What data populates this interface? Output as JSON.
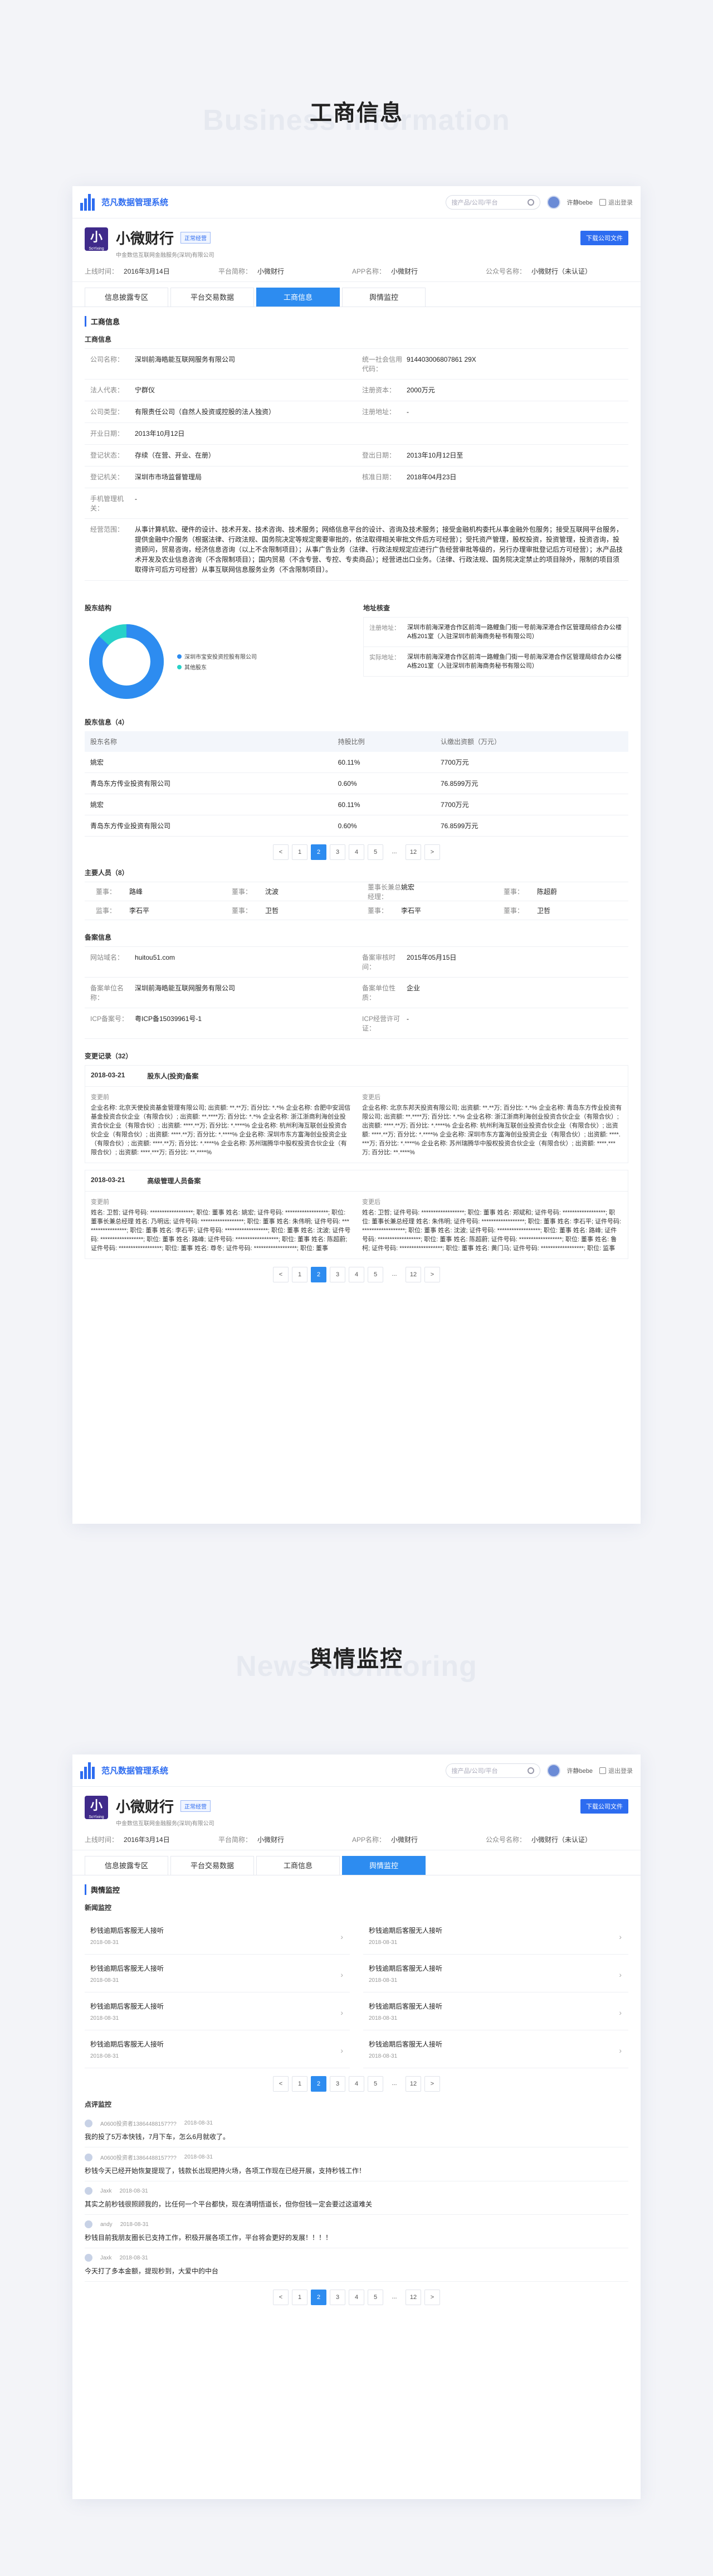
{
  "section1": {
    "title_zh": "工商信息",
    "title_en": "Business Information"
  },
  "section2": {
    "title_zh": "舆情监控",
    "title_en": "News Monitoring"
  },
  "topbar": {
    "system_name": "范凡数据管理系统",
    "search_placeholder": "搜产品/公司/平台",
    "username": "许静bebe",
    "logout": "退出登录"
  },
  "company": {
    "name": "小微财行",
    "tag": "正常经营",
    "subtitle": "中金数信互联网金融服务(深圳)有限公司",
    "download": "下载公司文件",
    "logo_text": "小",
    "logo_small": "SoYixing",
    "info": [
      {
        "k": "上线时间：",
        "v": "2016年3月14日"
      },
      {
        "k": "平台简称：",
        "v": "小微财行"
      },
      {
        "k": "APP名称：",
        "v": "小微财行"
      },
      {
        "k": "公众号名称：",
        "v": "小微财行（未认证）"
      }
    ]
  },
  "tabs": [
    "信息披露专区",
    "平台交易数据",
    "工商信息",
    "舆情监控"
  ],
  "biz": {
    "header": "工商信息",
    "sub1": "工商信息",
    "rows": [
      [
        {
          "k": "公司名称：",
          "v": "深圳前海皓能互联网服务有限公司"
        },
        {
          "k": "统一社会信用代码：",
          "v": "914403006807861 29X"
        }
      ],
      [
        {
          "k": "法人代表：",
          "v": "宁群仪"
        },
        {
          "k": "注册资本：",
          "v": "2000万元"
        }
      ],
      [
        {
          "k": "公司类型：",
          "v": "有限责任公司（自然人投资或控股的法人独资）"
        },
        {
          "k": "注册地址：",
          "v": "-"
        }
      ],
      [
        {
          "k": "开业日期：",
          "v": "2013年10月12日"
        },
        {
          "k": "",
          "v": ""
        }
      ],
      [
        {
          "k": "登记状态：",
          "v": "存续（在营、开业、在册）"
        },
        {
          "k": "登出日期：",
          "v": "2013年10月12日至"
        }
      ],
      [
        {
          "k": "登记机关：",
          "v": "深圳市市场监督管理局"
        },
        {
          "k": "核准日期：",
          "v": "2018年04月23日"
        }
      ],
      [
        {
          "k": "手机管理机关：",
          "v": "-"
        },
        {
          "k": "",
          "v": ""
        }
      ]
    ],
    "scope": {
      "k": "经营范围：",
      "v": "从事计算机软、硬件的设计、技术开发、技术咨询、技术服务；网络信息平台的设计、咨询及技术服务；接受金融机构委托从事金融外包服务；接受互联网平台服务，提供金融中介服务（根据法律、行政法规、国务院决定等规定需要审批的，依法取得相关审批文件后方可经营）；受托资产管理，股权投资，投资管理，投资咨询，投资顾问，贸易咨询，经济信息咨询（以上不含限制项目）；从事广告业务（法律、行政法规规定应进行广告经营审批等级的，另行办理审批登记后方可经营）；水产品技术开发及农业信息咨询（不含限制项目）；国内贸易（不含专营、专控、专卖商品）；经营进出口业务。（法律、行政法规、国务院决定禁止的项目除外，限制的项目须取得许可后方可经营）从事互联网信息服务业务（不含限制项目）。"
    },
    "sub_shareholder_struct": "股东结构",
    "donut_legend": [
      {
        "name": "深圳市宝安投资控股有限公司",
        "color": "#2d8cf0"
      },
      {
        "name": "其他股东",
        "color": "#27d1c8"
      }
    ],
    "sub_address": "地址核查",
    "address_rows": [
      {
        "k": "注册地址：",
        "v": "深圳市前海深港合作区前湾一路鲤鱼门街一号前海深港合作区管理局综合办公楼A栋201室（入驻深圳市前海商务秘书有限公司）"
      },
      {
        "k": "实际地址：",
        "v": "深圳市前海深港合作区前湾一路鲤鱼门街一号前海深港合作区管理局综合办公楼A栋201室（入驻深圳市前海商务秘书有限公司）"
      }
    ],
    "sub_shareholders": "股东信息（4）",
    "sh_headers": [
      "股东名称",
      "持股比例",
      "认缴出资额（万元）"
    ],
    "sh_rows": [
      [
        "姚宏",
        "60.11%",
        "7700万元"
      ],
      [
        "青岛东方传业投资有限公司",
        "0.60%",
        "76.8599万元"
      ],
      [
        "姚宏",
        "60.11%",
        "7700万元"
      ],
      [
        "青岛东方传业投资有限公司",
        "0.60%",
        "76.8599万元"
      ]
    ],
    "pager1": [
      "<",
      "1",
      "2",
      "3",
      "4",
      "5",
      "...",
      "12",
      ">"
    ],
    "sub_people": "主要人员（8）",
    "people_rows": [
      [
        {
          "k": "董事：",
          "v": "路峰"
        },
        {
          "k": "董事：",
          "v": "沈波"
        },
        {
          "k": "董事长兼总经理：",
          "v": "姚宏"
        },
        {
          "k": "董事：",
          "v": "陈超蔚"
        }
      ],
      [
        {
          "k": "监事：",
          "v": "李石平"
        },
        {
          "k": "董事：",
          "v": "卫哲"
        },
        {
          "k": "董事：",
          "v": "李石平"
        },
        {
          "k": "董事：",
          "v": "卫哲"
        }
      ]
    ],
    "sub_icp": "备案信息",
    "icp_rows": [
      [
        {
          "k": "网站域名：",
          "v": "huitou51.com"
        },
        {
          "k": "备案审核时间：",
          "v": "2015年05月15日"
        }
      ],
      [
        {
          "k": "备案单位名称：",
          "v": "深圳前海皓能互联网服务有限公司"
        },
        {
          "k": "备案单位性质：",
          "v": "企业"
        }
      ],
      [
        {
          "k": "ICP备案号：",
          "v": "粤ICP备15039961号-1"
        },
        {
          "k": "ICP经营许可证：",
          "v": "-"
        }
      ]
    ],
    "sub_changes": "变更记录（32）",
    "changes": [
      {
        "date": "2018-03-21",
        "title": "股东人(投资)备案",
        "before_lbl": "变更前",
        "before": "企业名称: 北京天使投资基金管理有限公司; 出资额: **.**万; 百分比: *.*% 企业名称: 合肥中安润信基金投资合伙企业（有限合伙）; 出资额: **.****万; 百分比: *.*% 企业名称: 浙江浙商利海创业投资合伙企业（有限合伙）; 出资额: ****.**万; 百分比: *.****% 企业名称: 杭州利海互联创业投资合伙企业（有限合伙）; 出资额: ****.**万; 百分比: *.****% 企业名称: 深圳市东方富海创业投资企业（有限合伙）; 出资额: ****.**万; 百分比: *.****% 企业名称: 苏州瑞腾华中股权投资合伙企业（有限合伙）; 出资额: ****.***万; 百分比: **.****%",
        "after_lbl": "变更后",
        "after": "企业名称: 北京东邦天投资有限公司; 出资额: **.**万; 百分比: *.*% 企业名称: 青岛东方传业投资有限公司; 出资额: **.****万; 百分比: *.*% 企业名称: 浙江浙商利海创业投资合伙企业（有限合伙）; 出资额: ****.**万; 百分比: *.****% 企业名称: 杭州利海互联创业投资合伙企业（有限合伙）; 出资额: ****.**万; 百分比: *.****% 企业名称: 深圳市东方富海创业投资企业（有限合伙）; 出资额: ****.***万; 百分比: *.****% 企业名称: 苏州瑞腾华中股权投资合伙企业（有限合伙）; 出资额: ****.***万; 百分比: **.****%"
      },
      {
        "date": "2018-03-21",
        "title": "高级管理人员备案",
        "before_lbl": "变更前",
        "before": "姓名: 卫哲; 证件号码: ******************; 职位: 董事 姓名: 姚宏; 证件号码: ******************; 职位: 董事长兼总经理 姓名: 乃明远; 证件号码: ******************; 职位: 董事 姓名: 朱伟明; 证件号码: ******************; 职位: 董事 姓名: 李石平; 证件号码: ******************; 职位: 董事 姓名: 沈波; 证件号码: ******************; 职位: 董事 姓名: 路峰; 证件号码: ******************; 职位: 董事 姓名: 陈超蔚; 证件号码: ******************; 职位: 董事 姓名: 尊冬; 证件号码: ******************; 职位: 董事",
        "after_lbl": "变更后",
        "after": "姓名: 卫哲; 证件号码: ******************; 职位: 董事 姓名: 郑斌和; 证件号码: ******************; 职位: 董事长兼总经理 姓名: 朱伟明; 证件号码: ******************; 职位: 董事 姓名: 李石平; 证件号码: ******************; 职位: 董事 姓名: 沈波; 证件号码: ******************; 职位: 董事 姓名: 路峰; 证件号码: ******************; 职位: 董事 姓名: 陈超蔚; 证件号码: ******************; 职位: 董事 姓名: 鲁柯; 证件号码: ******************; 职位: 董事 姓名: 黄门马; 证件号码: ******************; 职位: 监事"
      }
    ],
    "pager2": [
      "<",
      "1",
      "2",
      "3",
      "4",
      "5",
      "...",
      "12",
      ">"
    ]
  },
  "news": {
    "header": "舆情监控",
    "sub_news": "新闻监控",
    "items": [
      {
        "t": "秒钱逾期后客服无人接听",
        "d": "2018-08-31"
      },
      {
        "t": "秒钱逾期后客服无人接听",
        "d": "2018-08-31"
      },
      {
        "t": "秒钱逾期后客服无人接听",
        "d": "2018-08-31"
      },
      {
        "t": "秒钱逾期后客服无人接听",
        "d": "2018-08-31"
      },
      {
        "t": "秒钱逾期后客服无人接听",
        "d": "2018-08-31"
      },
      {
        "t": "秒钱逾期后客服无人接听",
        "d": "2018-08-31"
      },
      {
        "t": "秒钱逾期后客服无人接听",
        "d": "2018-08-31"
      },
      {
        "t": "秒钱逾期后客服无人接听",
        "d": "2018-08-31"
      }
    ],
    "pager": [
      "<",
      "1",
      "2",
      "3",
      "4",
      "5",
      "...",
      "12",
      ">"
    ],
    "sub_comments": "点评监控",
    "comments": [
      {
        "user": "A0600投资者13864488157???",
        "date": "2018-08-31",
        "text": "我的投了5万本快钱，7月下车，怎么6月就收了。"
      },
      {
        "user": "A0600投资者13864488157???",
        "date": "2018-08-31",
        "text": "秒钱今天已经开始恢复提现了，钱款长出现把持火场，各项工作现在已经开展，支持秒钱工作！"
      },
      {
        "user": "Jaxk",
        "date": "2018-08-31",
        "text": "其实之前秒钱很照顾我的，比任何一个平台都快，现在清明悟道长，但你但钱一定会要过这道难关"
      },
      {
        "user": "andy",
        "date": "2018-08-31",
        "text": "秒钱目前我朋友圈长已支持工作，积极开展各项工作，平台将会更好的发展！！！！"
      },
      {
        "user": "Jaxk",
        "date": "2018-08-31",
        "text": "今天打了多本金额，提现秒到，大爱中的中台"
      }
    ],
    "pager2": [
      "<",
      "1",
      "2",
      "3",
      "4",
      "5",
      "...",
      "12",
      ">"
    ]
  }
}
